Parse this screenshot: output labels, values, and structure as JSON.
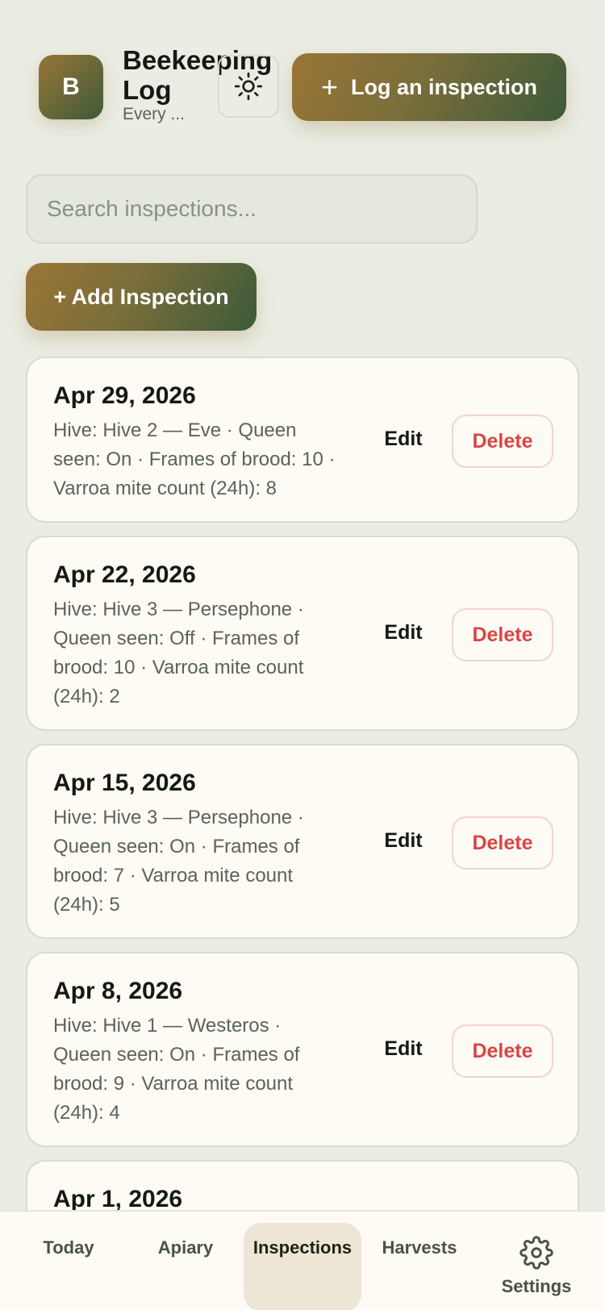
{
  "header": {
    "logo_letter": "B",
    "title": "Beekeeping Log",
    "subtitle": "Every ...",
    "theme_icon": "sun-icon",
    "log_button_label": "Log an inspection",
    "log_button_icon": "plus-icon"
  },
  "search": {
    "placeholder": "Search inspections...",
    "value": ""
  },
  "add_button_label": "+ Add Inspection",
  "inspections": [
    {
      "date": "Apr 29, 2026",
      "description": "Hive: Hive 2 — Eve · Queen seen: On · Frames of brood: 10 · Varroa mite count (24h): 8",
      "edit_label": "Edit",
      "delete_label": "Delete"
    },
    {
      "date": "Apr 22, 2026",
      "description": "Hive: Hive 3 — Persephone · Queen seen: Off · Frames of brood: 10 · Varroa mite count (24h): 2",
      "edit_label": "Edit",
      "delete_label": "Delete"
    },
    {
      "date": "Apr 15, 2026",
      "description": "Hive: Hive 3 — Persephone · Queen seen: On · Frames of brood: 7 · Varroa mite count (24h): 5",
      "edit_label": "Edit",
      "delete_label": "Delete"
    },
    {
      "date": "Apr 8, 2026",
      "description": "Hive: Hive 1 — Westeros · Queen seen: On · Frames of brood: 9 · Varroa mite count (24h): 4",
      "edit_label": "Edit",
      "delete_label": "Delete"
    },
    {
      "date": "Apr 1, 2026"
    }
  ],
  "nav": {
    "items": [
      {
        "label": "Today"
      },
      {
        "label": "Apiary"
      },
      {
        "label": "Inspections",
        "active": true
      },
      {
        "label": "Harvests"
      },
      {
        "label": "Settings",
        "icon": "gear-icon"
      }
    ]
  },
  "colors": {
    "accent_gold": "#9a7536",
    "accent_green": "#3d5a3a",
    "danger": "#d94545",
    "background": "#ebede4",
    "card": "#fdfbf4"
  }
}
